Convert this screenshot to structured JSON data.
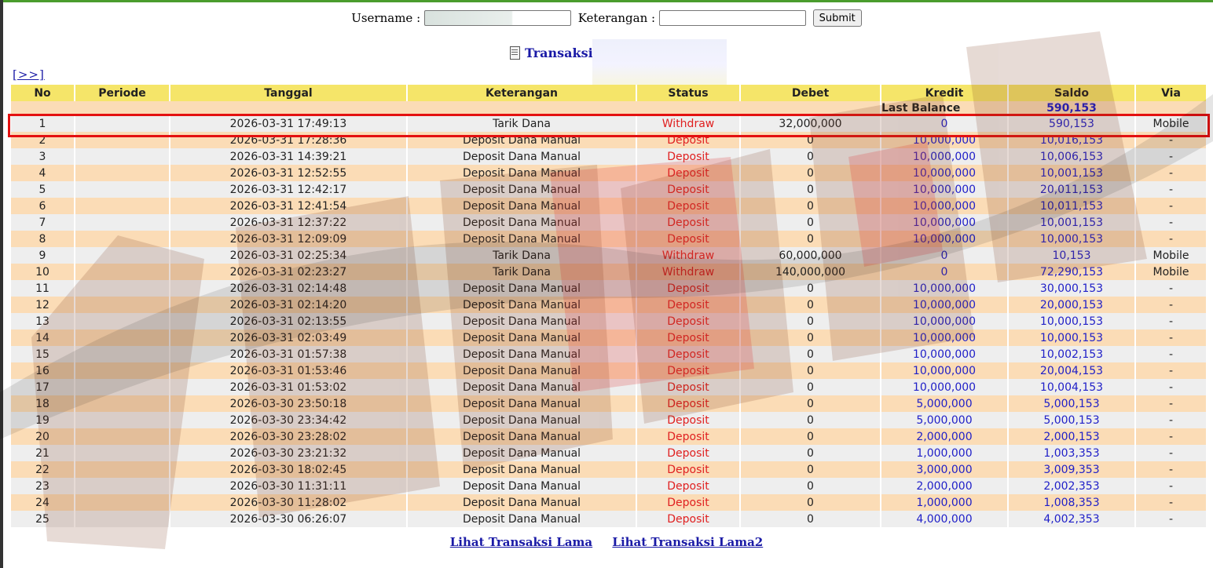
{
  "search": {
    "username_label": "Username :",
    "keterangan_label": "Keterangan :",
    "submit_label": "Submit"
  },
  "title": "Transaksi",
  "more_link": "[>>]",
  "table": {
    "headers": [
      "No",
      "Periode",
      "Tanggal",
      "Keterangan",
      "Status",
      "Debet",
      "Kredit",
      "Saldo",
      "Via"
    ],
    "last_balance_label": "Last Balance",
    "last_balance_value": "590,153",
    "rows": [
      {
        "no": "1",
        "periode": "",
        "tanggal": "2026-03-31 17:49:13",
        "keterangan": "Tarik Dana",
        "status": "Withdraw",
        "debet": "32,000,000",
        "kredit": "0",
        "saldo": "590,153",
        "via": "Mobile"
      },
      {
        "no": "2",
        "periode": "",
        "tanggal": "2026-03-31 17:28:36",
        "keterangan": "Deposit Dana Manual",
        "status": "Deposit",
        "debet": "0",
        "kredit": "10,000,000",
        "saldo": "10,016,153",
        "via": "-"
      },
      {
        "no": "3",
        "periode": "",
        "tanggal": "2026-03-31 14:39:21",
        "keterangan": "Deposit Dana Manual",
        "status": "Deposit",
        "debet": "0",
        "kredit": "10,000,000",
        "saldo": "10,006,153",
        "via": "-"
      },
      {
        "no": "4",
        "periode": "",
        "tanggal": "2026-03-31 12:52:55",
        "keterangan": "Deposit Dana Manual",
        "status": "Deposit",
        "debet": "0",
        "kredit": "10,000,000",
        "saldo": "10,001,153",
        "via": "-"
      },
      {
        "no": "5",
        "periode": "",
        "tanggal": "2026-03-31 12:42:17",
        "keterangan": "Deposit Dana Manual",
        "status": "Deposit",
        "debet": "0",
        "kredit": "10,000,000",
        "saldo": "20,011,153",
        "via": "-"
      },
      {
        "no": "6",
        "periode": "",
        "tanggal": "2026-03-31 12:41:54",
        "keterangan": "Deposit Dana Manual",
        "status": "Deposit",
        "debet": "0",
        "kredit": "10,000,000",
        "saldo": "10,011,153",
        "via": "-"
      },
      {
        "no": "7",
        "periode": "",
        "tanggal": "2026-03-31 12:37:22",
        "keterangan": "Deposit Dana Manual",
        "status": "Deposit",
        "debet": "0",
        "kredit": "10,000,000",
        "saldo": "10,001,153",
        "via": "-"
      },
      {
        "no": "8",
        "periode": "",
        "tanggal": "2026-03-31 12:09:09",
        "keterangan": "Deposit Dana Manual",
        "status": "Deposit",
        "debet": "0",
        "kredit": "10,000,000",
        "saldo": "10,000,153",
        "via": "-"
      },
      {
        "no": "9",
        "periode": "",
        "tanggal": "2026-03-31 02:25:34",
        "keterangan": "Tarik Dana",
        "status": "Withdraw",
        "debet": "60,000,000",
        "kredit": "0",
        "saldo": "10,153",
        "via": "Mobile"
      },
      {
        "no": "10",
        "periode": "",
        "tanggal": "2026-03-31 02:23:27",
        "keterangan": "Tarik Dana",
        "status": "Withdraw",
        "debet": "140,000,000",
        "kredit": "0",
        "saldo": "72,290,153",
        "via": "Mobile"
      },
      {
        "no": "11",
        "periode": "",
        "tanggal": "2026-03-31 02:14:48",
        "keterangan": "Deposit Dana Manual",
        "status": "Deposit",
        "debet": "0",
        "kredit": "10,000,000",
        "saldo": "30,000,153",
        "via": "-"
      },
      {
        "no": "12",
        "periode": "",
        "tanggal": "2026-03-31 02:14:20",
        "keterangan": "Deposit Dana Manual",
        "status": "Deposit",
        "debet": "0",
        "kredit": "10,000,000",
        "saldo": "20,000,153",
        "via": "-"
      },
      {
        "no": "13",
        "periode": "",
        "tanggal": "2026-03-31 02:13:55",
        "keterangan": "Deposit Dana Manual",
        "status": "Deposit",
        "debet": "0",
        "kredit": "10,000,000",
        "saldo": "10,000,153",
        "via": "-"
      },
      {
        "no": "14",
        "periode": "",
        "tanggal": "2026-03-31 02:03:49",
        "keterangan": "Deposit Dana Manual",
        "status": "Deposit",
        "debet": "0",
        "kredit": "10,000,000",
        "saldo": "10,000,153",
        "via": "-"
      },
      {
        "no": "15",
        "periode": "",
        "tanggal": "2026-03-31 01:57:38",
        "keterangan": "Deposit Dana Manual",
        "status": "Deposit",
        "debet": "0",
        "kredit": "10,000,000",
        "saldo": "10,002,153",
        "via": "-"
      },
      {
        "no": "16",
        "periode": "",
        "tanggal": "2026-03-31 01:53:46",
        "keterangan": "Deposit Dana Manual",
        "status": "Deposit",
        "debet": "0",
        "kredit": "10,000,000",
        "saldo": "20,004,153",
        "via": "-"
      },
      {
        "no": "17",
        "periode": "",
        "tanggal": "2026-03-31 01:53:02",
        "keterangan": "Deposit Dana Manual",
        "status": "Deposit",
        "debet": "0",
        "kredit": "10,000,000",
        "saldo": "10,004,153",
        "via": "-"
      },
      {
        "no": "18",
        "periode": "",
        "tanggal": "2026-03-30 23:50:18",
        "keterangan": "Deposit Dana Manual",
        "status": "Deposit",
        "debet": "0",
        "kredit": "5,000,000",
        "saldo": "5,000,153",
        "via": "-"
      },
      {
        "no": "19",
        "periode": "",
        "tanggal": "2026-03-30 23:34:42",
        "keterangan": "Deposit Dana Manual",
        "status": "Deposit",
        "debet": "0",
        "kredit": "5,000,000",
        "saldo": "5,000,153",
        "via": "-"
      },
      {
        "no": "20",
        "periode": "",
        "tanggal": "2026-03-30 23:28:02",
        "keterangan": "Deposit Dana Manual",
        "status": "Deposit",
        "debet": "0",
        "kredit": "2,000,000",
        "saldo": "2,000,153",
        "via": "-"
      },
      {
        "no": "21",
        "periode": "",
        "tanggal": "2026-03-30 23:21:32",
        "keterangan": "Deposit Dana Manual",
        "status": "Deposit",
        "debet": "0",
        "kredit": "1,000,000",
        "saldo": "1,003,353",
        "via": "-"
      },
      {
        "no": "22",
        "periode": "",
        "tanggal": "2026-03-30 18:02:45",
        "keterangan": "Deposit Dana Manual",
        "status": "Deposit",
        "debet": "0",
        "kredit": "3,000,000",
        "saldo": "3,009,353",
        "via": "-"
      },
      {
        "no": "23",
        "periode": "",
        "tanggal": "2026-03-30 11:31:11",
        "keterangan": "Deposit Dana Manual",
        "status": "Deposit",
        "debet": "0",
        "kredit": "2,000,000",
        "saldo": "2,002,353",
        "via": "-"
      },
      {
        "no": "24",
        "periode": "",
        "tanggal": "2026-03-30 11:28:02",
        "keterangan": "Deposit Dana Manual",
        "status": "Deposit",
        "debet": "0",
        "kredit": "1,000,000",
        "saldo": "1,008,353",
        "via": "-"
      },
      {
        "no": "25",
        "periode": "",
        "tanggal": "2026-03-30 06:26:07",
        "keterangan": "Deposit Dana Manual",
        "status": "Deposit",
        "debet": "0",
        "kredit": "4,000,000",
        "saldo": "4,002,353",
        "via": "-"
      }
    ]
  },
  "footer": {
    "link1": "Lihat Transaksi Lama",
    "link2": "Lihat Transaksi Lama2"
  },
  "colors": {
    "header_bg": "#f5e569",
    "row_odd_bg": "#eeeeee",
    "row_even_bg": "#fbdcb6",
    "status_red": "#e02020",
    "link_blue": "#1a1aa6",
    "highlight_red": "#e41010"
  },
  "icons": {
    "title_icon": "document-icon"
  }
}
